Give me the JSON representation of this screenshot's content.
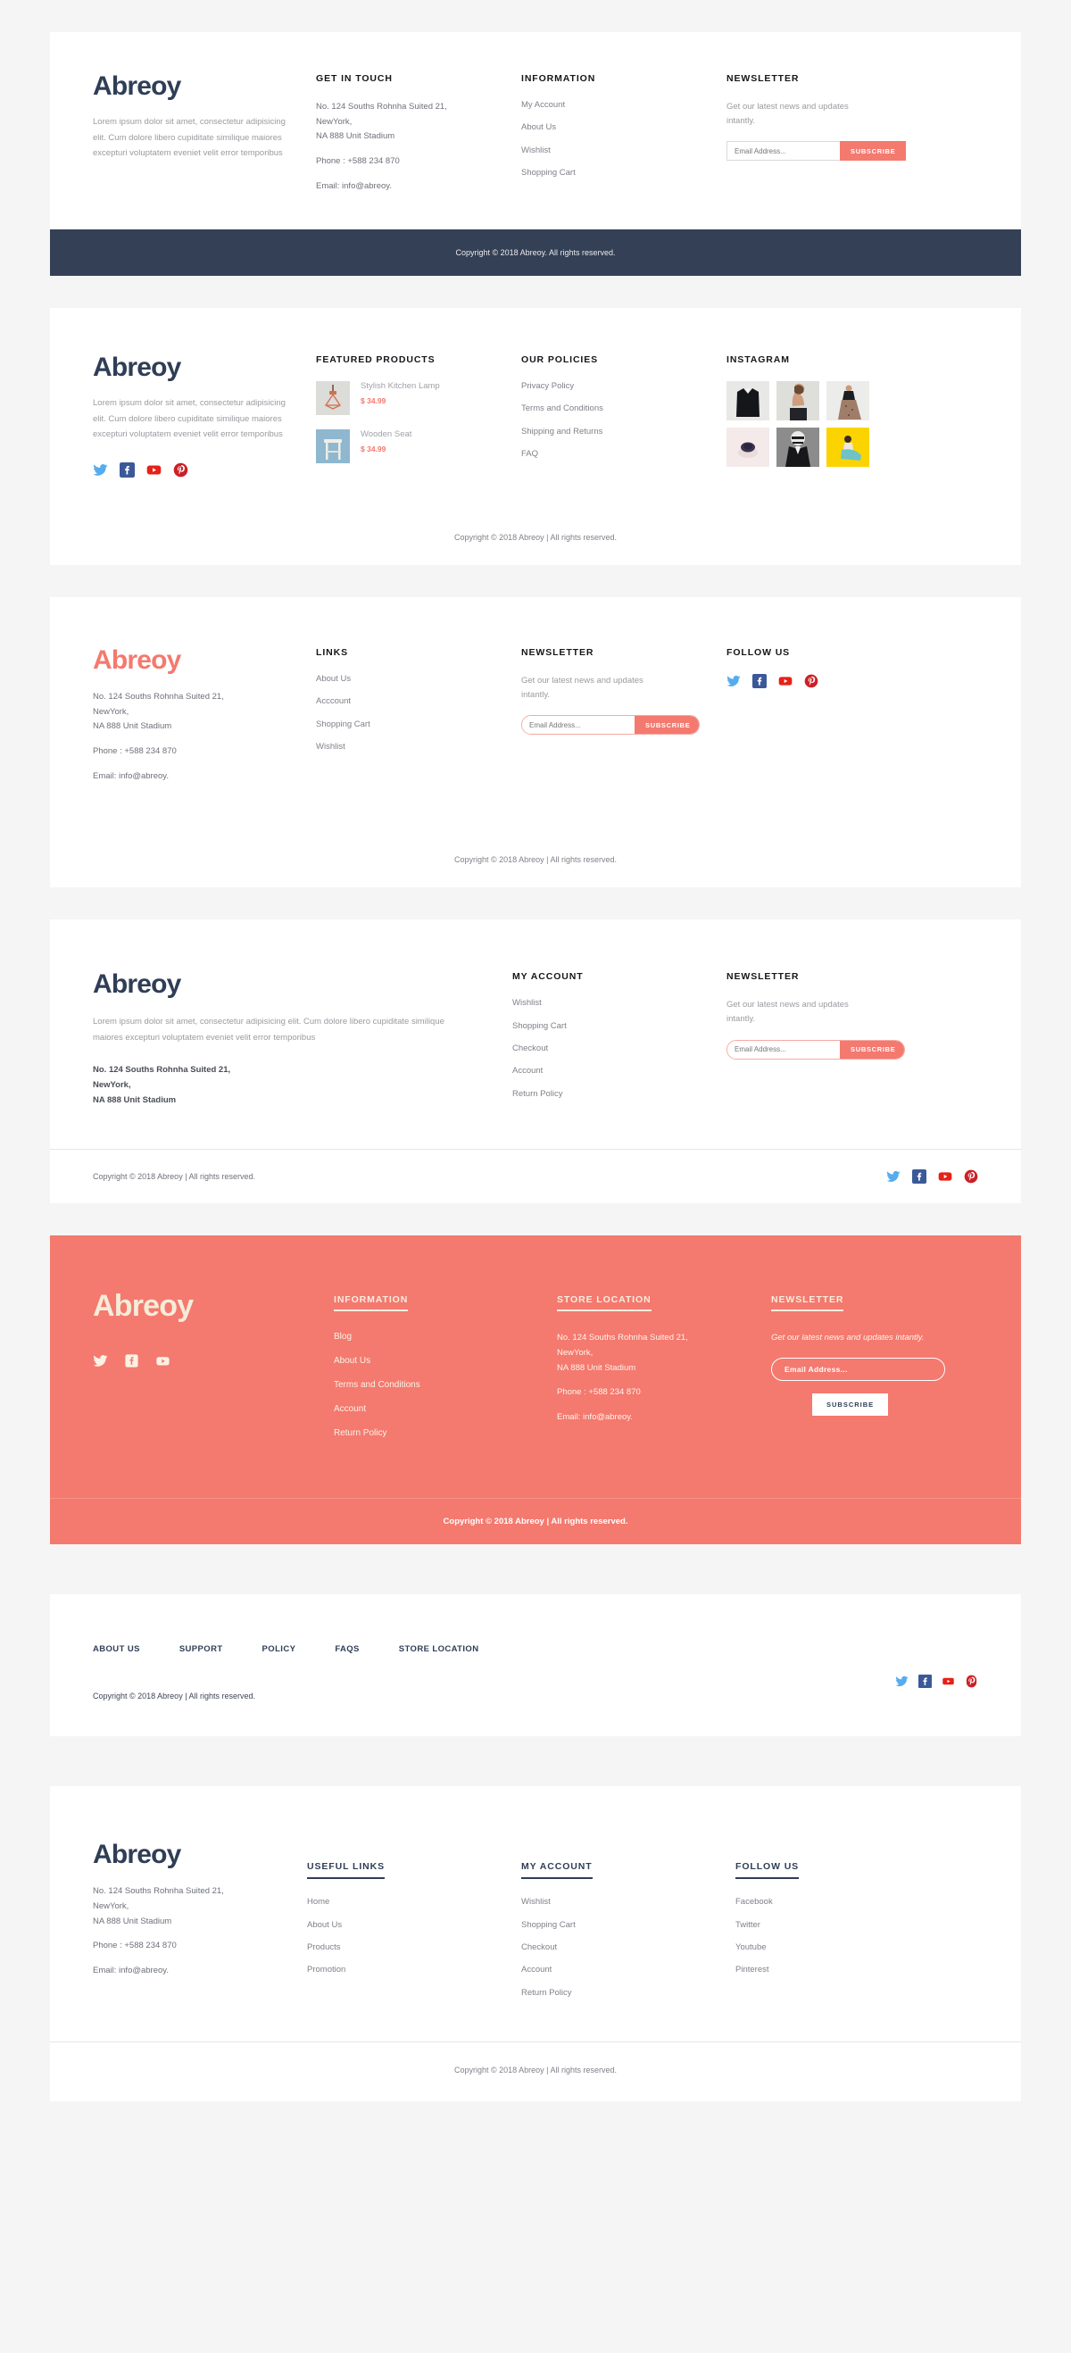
{
  "brand": {
    "name": "Abreoy"
  },
  "common": {
    "lorem_short": "Lorem ipsum dolor sit amet, consectetur adipisicing elit. Cum dolore libero cupiditate similique maiores excepturi voluptatem eveniet velit error temporibus",
    "lorem_wide": "Lorem ipsum dolor sit amet, consectetur adipisicing elit. Cum dolore libero cupiditate similique maiores excepturi voluptatem  eveniet  velit error temporibus",
    "address_line1": "No. 124 Souths Rohnha Suited 21,",
    "address_line2": "NewYork,",
    "address_line3": "NA 888 Unit Stadium",
    "phone": "Phone : +588 234 870",
    "email": "Email: info@abreoy.",
    "newsletter_text": "Get our latest news and updates intantly.",
    "email_placeholder": "Email Address...",
    "subscribe_label": "SUBSCRIBE"
  },
  "footer1": {
    "copyright": "Copyright © 2018 Abreoy. All rights reserved.",
    "columns": {
      "get_in_touch": {
        "title": "GET IN TOUCH"
      },
      "information": {
        "title": "INFORMATION",
        "links": [
          "My Account",
          "About Us",
          "Wishlist",
          "Shopping Cart"
        ]
      },
      "newsletter": {
        "title": "NEWSLETTER"
      }
    }
  },
  "footer2": {
    "copyright": "Copyright © 2018 Abreoy  | All rights reserved.",
    "featured": {
      "title": "FEATURED PRODUCTS",
      "products": [
        {
          "name": "Stylish Kitchen Lamp",
          "price": "$ 34.99",
          "image": "kitchen-lamp"
        },
        {
          "name": "Wooden Seat",
          "price": "$ 34.99",
          "image": "wooden-seat"
        }
      ]
    },
    "policies": {
      "title": "OUR POLICIES",
      "links": [
        "Privacy Policy",
        "Terms and Conditions",
        "Shipping and Returns",
        "FAQ"
      ]
    },
    "instagram": {
      "title": "INSTAGRAM",
      "cells": [
        "black-blazer",
        "back-pose",
        "patterned-skirt",
        "pink-ring",
        "masked-man",
        "yellow-backdrop"
      ]
    },
    "socials": [
      "twitter",
      "facebook",
      "youtube",
      "pinterest"
    ]
  },
  "footer3": {
    "copyright": "Copyright © 2018 Abreoy  | All rights reserved.",
    "links": {
      "title": "LINKS",
      "items": [
        "About Us",
        "Acccount",
        "Shopping Cart",
        "Wishlist"
      ]
    },
    "newsletter": {
      "title": "NEWSLETTER"
    },
    "follow": {
      "title": "FOLLOW US",
      "socials": [
        "twitter",
        "facebook",
        "youtube",
        "pinterest"
      ]
    }
  },
  "footer4": {
    "copyright": "Copyright © 2018 Abreoy  | All rights reserved.",
    "my_account": {
      "title": "MY ACCOUNT",
      "items": [
        "Wishlist",
        "Shopping Cart",
        "Checkout",
        "Account",
        "Return Policy"
      ]
    },
    "newsletter": {
      "title": "NEWSLETTER"
    },
    "socials": [
      "twitter",
      "facebook",
      "youtube",
      "pinterest"
    ]
  },
  "footer5": {
    "copyright": "Copyright © 2018 Abreoy  | All rights reserved.",
    "socials": [
      "twitter",
      "facebook",
      "youtube"
    ],
    "information": {
      "title": "INFORMATION",
      "items": [
        "Blog",
        "About Us",
        "Terms and Conditions",
        "Account",
        "Return Policy"
      ]
    },
    "store_location": {
      "title": "STORE LOCATION"
    },
    "newsletter": {
      "title": "NEWSLETTER"
    }
  },
  "footer6": {
    "nav": [
      "ABOUT US",
      "SUPPORT",
      "POLICY",
      "FAQS",
      "STORE LOCATION"
    ],
    "copyright": "Copyright © 2018 Abreoy  | All rights reserved.",
    "socials": [
      "twitter",
      "facebook",
      "youtube",
      "pinterest"
    ]
  },
  "footer7": {
    "copyright": "Copyright © 2018 Abreoy  | All rights reserved.",
    "useful_links": {
      "title": "USEFUL LINKS",
      "items": [
        "Home",
        "About Us",
        "Products",
        "Promotion"
      ]
    },
    "my_account": {
      "title": "MY ACCOUNT",
      "items": [
        "Wishlist",
        "Shopping Cart",
        "Checkout",
        "Account",
        "Return Policy"
      ]
    },
    "follow": {
      "title": "FOLLOW US",
      "items": [
        "Facebook",
        "Twitter",
        "Youtube",
        "Pinterest"
      ]
    }
  },
  "colors": {
    "coral": "#f4796f",
    "navy": "#2f3e56",
    "cream": "#f7eedf",
    "page_bg": "#f5f5f6",
    "twitter": "#55acee",
    "facebook": "#3b5998",
    "youtube": "#e62117",
    "pinterest": "#cb2027"
  }
}
